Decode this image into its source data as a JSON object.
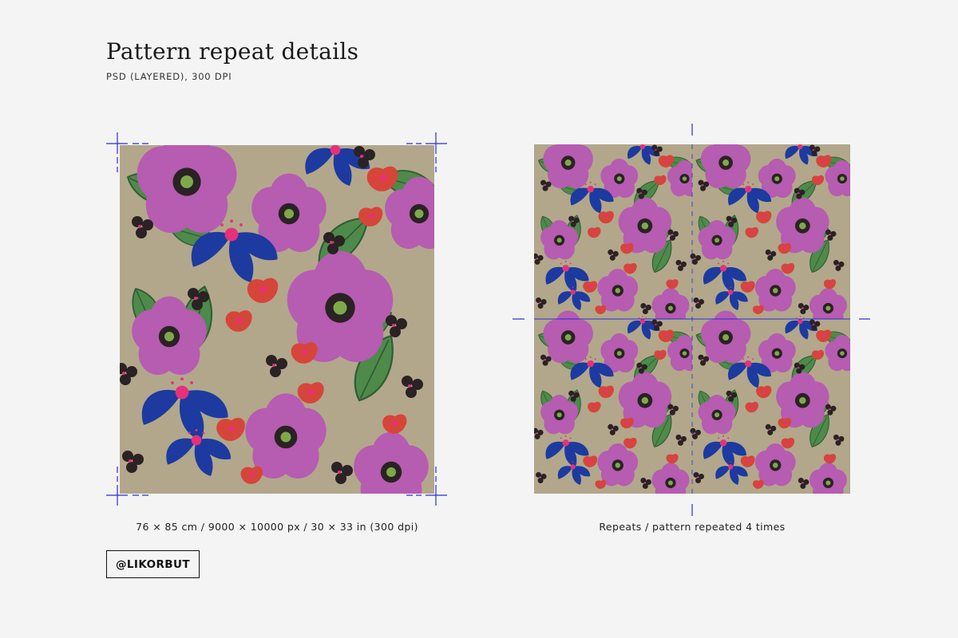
{
  "heading": {
    "title": "Pattern repeat details",
    "subtitle": "PSD (LAYERED), 300 DPI"
  },
  "single_tile": {
    "caption": "76 × 85 cm / 9000 × 10000 px / 30 × 33 in (300 dpi)"
  },
  "repeat_preview": {
    "caption": "Repeats / pattern repeated 4 times",
    "repeat_count": 4
  },
  "badge": {
    "label": "@LIKORBUT"
  },
  "palette": {
    "background": "#b2a78b",
    "leaf": "#4e8a4a",
    "leaf_dark": "#2f5d34",
    "purple_flower": "#b65cb1",
    "blue_flower": "#1c3aa0",
    "red_flower": "#d6453a",
    "pink_accent": "#e8307a",
    "berry": "#2a2224",
    "guide_line": "#2b2bd9"
  }
}
